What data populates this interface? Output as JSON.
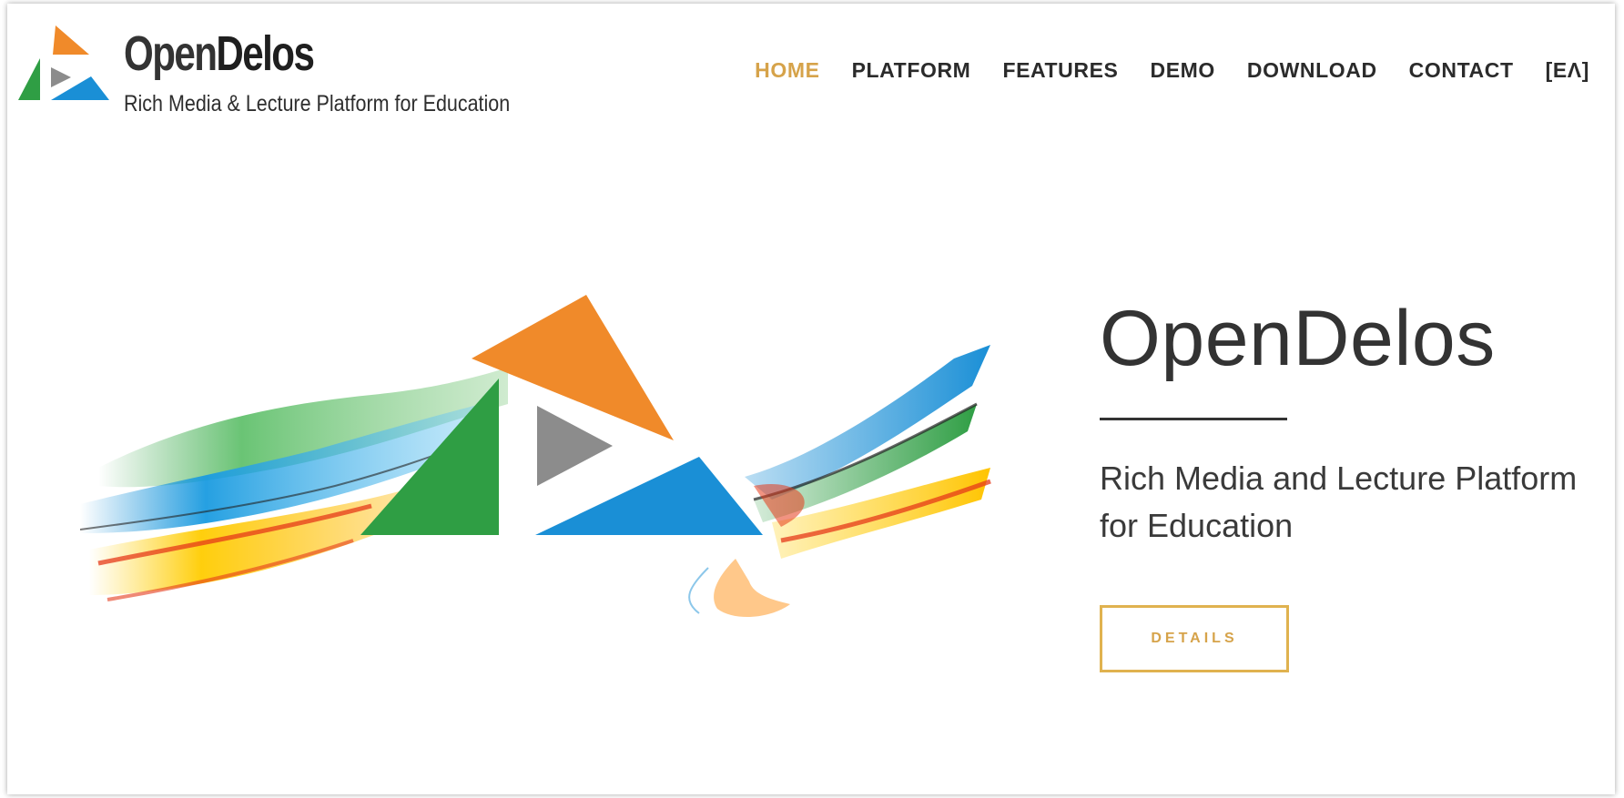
{
  "brand": {
    "title_open": "Open",
    "title_delos": "Delos",
    "tagline": "Rich Media & Lecture Platform for Education"
  },
  "nav": {
    "items": [
      "HOME",
      "PLATFORM",
      "FEATURES",
      "DEMO",
      "DOWNLOAD",
      "CONTACT",
      "[ΕΛ]"
    ],
    "active": "HOME"
  },
  "hero": {
    "title": "OpenDelos",
    "subtitle": "Rich Media and Lecture Platform for Education",
    "button_label": "DETAILS"
  },
  "colors": {
    "accent": "#d6a34a",
    "orange": "#f08a2a",
    "green": "#2f9e44",
    "blue": "#1a8fd6",
    "gray": "#8c8c8c",
    "text": "#333333"
  },
  "icons": {
    "logo": "opendelos-triangles-logo"
  }
}
